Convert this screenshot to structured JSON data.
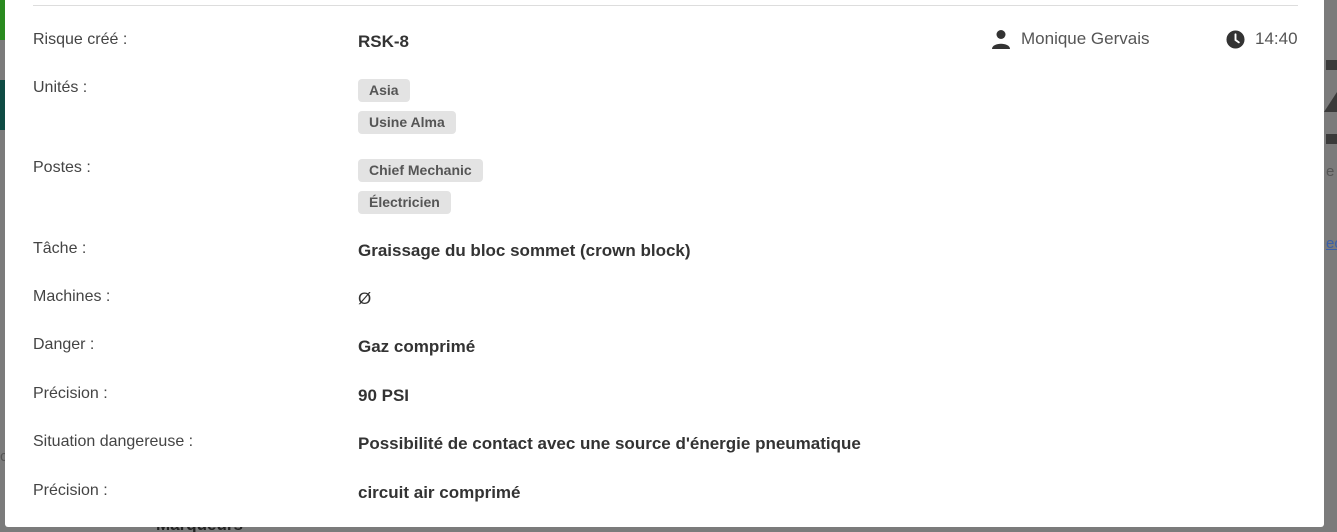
{
  "background": {
    "partial_text_right_1": "e",
    "partial_text_right_2": "ec",
    "partial_text_left": "ca",
    "partial_heading": "Marqueurs"
  },
  "header": {
    "user_name": "Monique Gervais",
    "time": "14:40",
    "icons": {
      "user": "user-icon",
      "clock": "clock-icon"
    }
  },
  "details": {
    "risk": {
      "label": "Risque créé :",
      "value": "RSK-8"
    },
    "units": {
      "label": "Unités :",
      "tags": [
        "Asia",
        "Usine Alma"
      ]
    },
    "positions": {
      "label": "Postes :",
      "tags": [
        "Chief Mechanic",
        "Électricien"
      ]
    },
    "task": {
      "label": "Tâche :",
      "value": "Graissage du bloc sommet (crown block)"
    },
    "machines": {
      "label": "Machines :",
      "value": "Ø"
    },
    "danger": {
      "label": "Danger :",
      "value": "Gaz comprimé"
    },
    "danger_precision": {
      "label": "Précision :",
      "value": "90 PSI"
    },
    "situation": {
      "label": "Situation dangereuse :",
      "value": "Possibilité de contact avec une source d'énergie pneumatique"
    },
    "situation_precision": {
      "label": "Précision :",
      "value": "circuit air comprimé"
    }
  },
  "colors": {
    "overlay": "#7b7b7b",
    "tag_bg": "#e3e3e3",
    "text": "#333333"
  }
}
